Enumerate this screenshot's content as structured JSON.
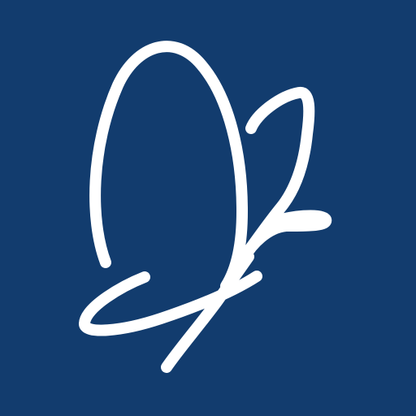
{
  "app_icon": {
    "icon": "butterfly-icon",
    "background_color": "#123c6e",
    "foreground_color": "#ffffff"
  }
}
